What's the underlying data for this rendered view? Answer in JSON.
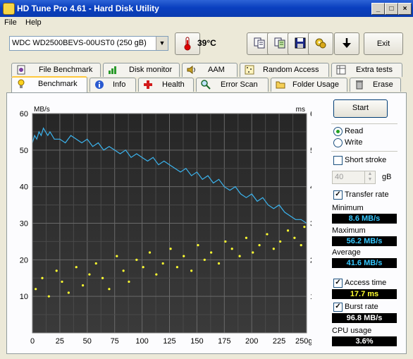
{
  "window": {
    "title": "HD Tune Pro 4.61 - Hard Disk Utility"
  },
  "menu": [
    "File",
    "Help"
  ],
  "toolbar": {
    "drive": "WDC WD2500BEVS-00UST0 (250 gB)",
    "temperature": "39°C",
    "exit_label": "Exit",
    "icons": [
      "copy-icon",
      "copy-text-icon",
      "save-icon",
      "options-icon",
      "down-arrow-icon"
    ]
  },
  "tabs_top": [
    "File Benchmark",
    "Disk monitor",
    "AAM",
    "Random Access",
    "Extra tests"
  ],
  "tabs_bottom": [
    "Benchmark",
    "Info",
    "Health",
    "Error Scan",
    "Folder Usage",
    "Erase"
  ],
  "active_tab": "Benchmark",
  "side": {
    "start_label": "Start",
    "read_label": "Read",
    "write_label": "Write",
    "read_selected": true,
    "short_stroke_label": "Short stroke",
    "short_stroke_checked": false,
    "short_stroke_value": "40",
    "short_stroke_unit": "gB",
    "transfer_rate_label": "Transfer rate",
    "transfer_rate_checked": true,
    "minimum_label": "Minimum",
    "minimum_value": "8.6 MB/s",
    "maximum_label": "Maximum",
    "maximum_value": "56.2 MB/s",
    "average_label": "Average",
    "average_value": "41.6 MB/s",
    "access_time_label": "Access time",
    "access_time_checked": true,
    "access_time_value": "17.7 ms",
    "burst_rate_label": "Burst rate",
    "burst_rate_checked": true,
    "burst_rate_value": "96.8 MB/s",
    "cpu_usage_label": "CPU usage",
    "cpu_usage_value": "3.6%"
  },
  "colors": {
    "transfer": "#3cb4ee",
    "access": "#ffff30",
    "plot_bg": "#2b2b2b",
    "grid": "#555555"
  },
  "chart_data": {
    "type": "line",
    "ylabel_left": "MB/s",
    "ylabel_right": "ms",
    "xlabel": "gB",
    "x_ticks": [
      "0",
      "25",
      "50",
      "75",
      "100",
      "125",
      "150",
      "175",
      "200",
      "225",
      "250gB"
    ],
    "y_ticks": [
      "10",
      "20",
      "30",
      "40",
      "50",
      "60"
    ],
    "xlim": [
      0,
      250
    ],
    "ylim": [
      0,
      60
    ],
    "series": [
      {
        "x": [
          0,
          2,
          4,
          6,
          8,
          10,
          12,
          14,
          16,
          18,
          20,
          25,
          30,
          35,
          40,
          45,
          50,
          55,
          60,
          65,
          70,
          75,
          80,
          85,
          90,
          95,
          100,
          105,
          110,
          115,
          120,
          125,
          130,
          135,
          140,
          145,
          150,
          155,
          160,
          165,
          170,
          175,
          180,
          185,
          190,
          195,
          200,
          205,
          210,
          215,
          220,
          225,
          230,
          235,
          240,
          245,
          250
        ],
        "y": [
          52,
          54,
          53,
          55,
          54,
          56,
          55,
          54,
          55,
          54,
          53,
          53,
          52,
          54,
          53,
          52,
          53,
          51,
          52,
          50,
          51,
          50,
          49,
          50,
          48,
          49,
          48,
          47,
          48,
          46,
          47,
          46,
          45,
          44,
          45,
          43,
          44,
          42,
          43,
          41,
          42,
          40,
          39,
          40,
          38,
          37,
          38,
          36,
          37,
          35,
          34,
          35,
          33,
          32,
          31,
          31,
          30
        ]
      },
      {
        "x": [
          3,
          9,
          15,
          22,
          27,
          33,
          40,
          46,
          52,
          58,
          64,
          70,
          77,
          83,
          88,
          95,
          101,
          107,
          113,
          119,
          126,
          132,
          138,
          145,
          151,
          157,
          163,
          170,
          176,
          182,
          189,
          195,
          201,
          207,
          214,
          220,
          226,
          233,
          239,
          245,
          248
        ],
        "y": [
          12,
          15,
          10,
          17,
          14,
          11,
          18,
          13,
          16,
          19,
          15,
          12,
          21,
          17,
          14,
          20,
          18,
          22,
          16,
          19,
          23,
          18,
          21,
          17,
          24,
          20,
          22,
          19,
          25,
          23,
          21,
          26,
          22,
          24,
          27,
          23,
          25,
          28,
          26,
          24,
          29
        ]
      }
    ]
  }
}
